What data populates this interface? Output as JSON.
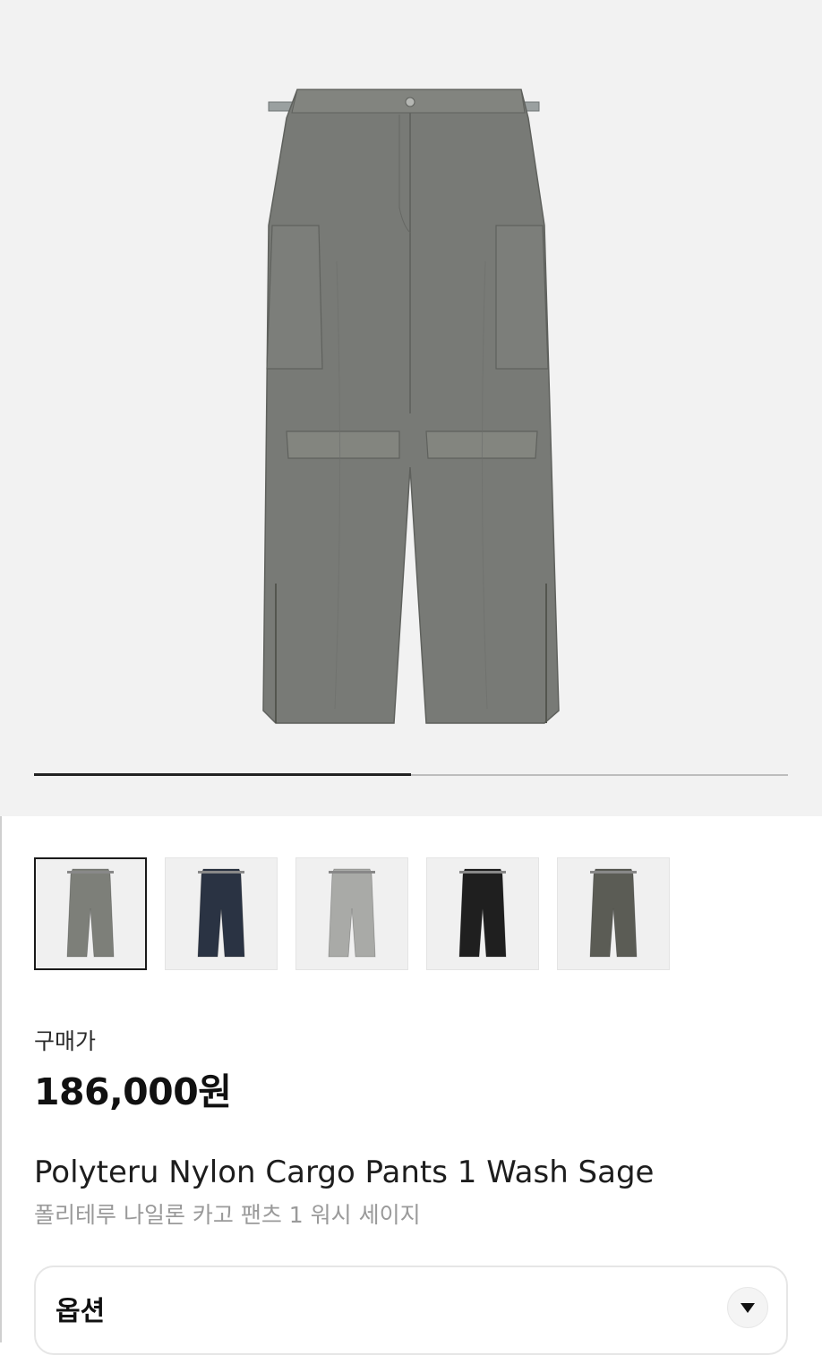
{
  "gallery": {
    "main_image_alt": "Polyteru Nylon Cargo Pants 1 Wash Sage",
    "progress_fraction": 0.5,
    "colors": {
      "hero_bg": "#f2f2f2",
      "track": "#bdbdbd",
      "fill": "#222222"
    }
  },
  "thumbnails": [
    {
      "name": "thumbnail-sage",
      "color": "#7d7f79",
      "selected": true
    },
    {
      "name": "thumbnail-navy",
      "color": "#2a3343",
      "selected": false
    },
    {
      "name": "thumbnail-light-grey",
      "color": "#a9aaa7",
      "selected": false
    },
    {
      "name": "thumbnail-black",
      "color": "#1f1f1f",
      "selected": false
    },
    {
      "name": "thumbnail-olive",
      "color": "#5b5c55",
      "selected": false
    }
  ],
  "product": {
    "price_label": "구매가",
    "price": "186,000원",
    "title_en": "Polyteru Nylon Cargo Pants 1 Wash Sage",
    "title_ko": "폴리테루 나일론 카고 팬츠 1 워시 세이지"
  },
  "option": {
    "label": "옵션",
    "icon": "chevron-down-icon"
  }
}
